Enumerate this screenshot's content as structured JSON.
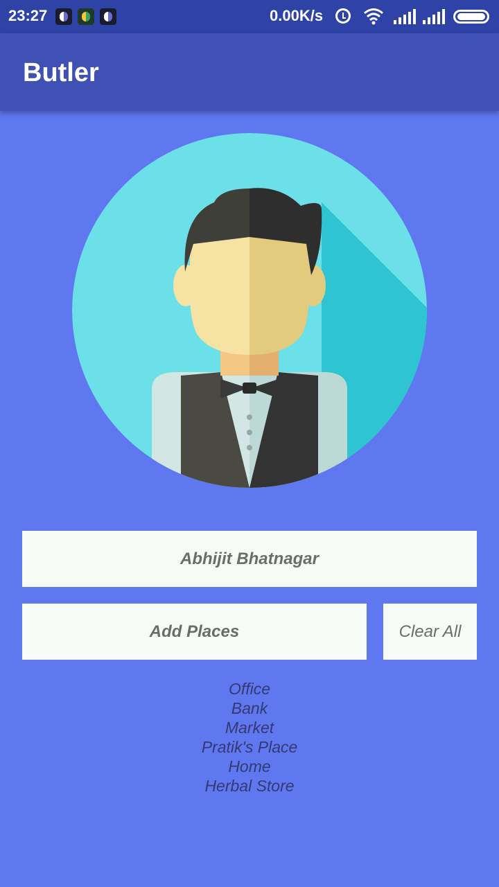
{
  "status_bar": {
    "time": "23:27",
    "network_speed": "0.00K/s",
    "icons": [
      "app-notification-icon",
      "app-notification-icon",
      "app-notification-icon",
      "alarm-icon",
      "wifi-icon",
      "signal-icon",
      "signal-icon",
      "battery-icon"
    ]
  },
  "app_bar": {
    "title": "Butler"
  },
  "avatar": {
    "icon": "butler-avatar-icon",
    "colors": {
      "circle": "#6ce0e8",
      "shadow": "#2ec4d2",
      "hair": "#3a3a3a",
      "skin": "#f6e3a4",
      "vest": "#3d3d3d"
    }
  },
  "name_field": {
    "value": "Abhijit Bhatnagar"
  },
  "actions": {
    "add_places_label": "Add Places",
    "clear_all_label": "Clear All"
  },
  "places": [
    "Office",
    "Bank",
    "Market",
    "Pratik's Place",
    "Home",
    "Herbal Store"
  ],
  "colors": {
    "background": "#5f77ef",
    "app_bar": "#3f51b5",
    "status_bar": "#2f42a6",
    "field_bg": "#f6fbf5",
    "place_text": "#333a72"
  }
}
